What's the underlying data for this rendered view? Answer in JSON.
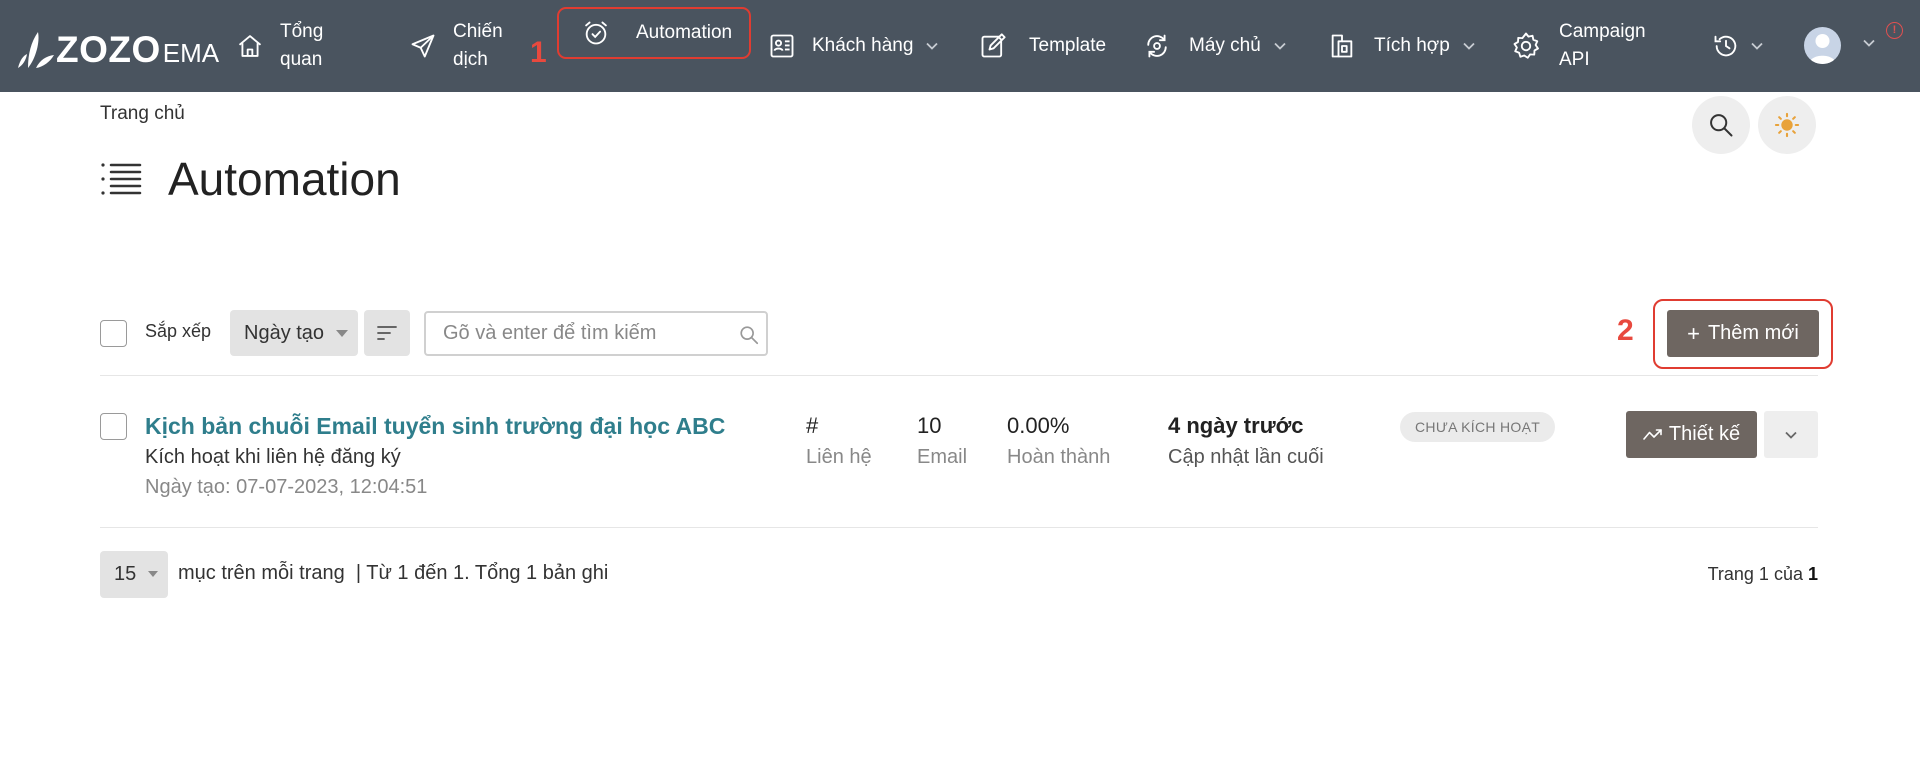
{
  "nav": {
    "brand": {
      "zozo": "ZOZO",
      "ema": "EMA"
    },
    "items": [
      {
        "label_line1": "Tổng",
        "label_line2": "quan",
        "icon": "home-icon"
      },
      {
        "label_line1": "Chiến",
        "label_line2": "dịch",
        "icon": "paper-plane-icon"
      },
      {
        "label": "Automation",
        "icon": "alarm-clock-icon",
        "active": true
      },
      {
        "label": "Khách hàng",
        "icon": "contacts-icon",
        "dropdown": true
      },
      {
        "label": "Template",
        "icon": "edit-icon"
      },
      {
        "label": "Máy chủ",
        "icon": "sync-server-icon",
        "dropdown": true
      },
      {
        "label": "Tích hợp",
        "icon": "integration-icon",
        "dropdown": true
      },
      {
        "label_line1": "Campaign",
        "label_line2": "API",
        "icon": "gear-icon"
      }
    ],
    "annotation_1": "1",
    "info_symbol": "!"
  },
  "breadcrumb": "Trang chủ",
  "page_title": "Automation",
  "toolbar": {
    "sort_label": "Sắp xếp",
    "sort_value": "Ngày tạo",
    "search_placeholder": "Gõ và enter để tìm kiếm",
    "add_label": "Thêm mới",
    "add_plus": "+",
    "annotation_2": "2"
  },
  "rows": [
    {
      "title": "Kịch bản chuỗi Email tuyển sinh trường đại học ABC",
      "trigger": "Kích hoạt khi liên hệ đăng ký",
      "created": "Ngày tạo: 07-07-2023, 12:04:51",
      "contacts_value": "#",
      "contacts_label": "Liên hệ",
      "emails_value": "10",
      "emails_label": "Email",
      "completion_value": "0.00%",
      "completion_label": "Hoàn thành",
      "updated_value": "4 ngày trước",
      "updated_label": "Cập nhật lần cuối",
      "status": "CHƯA KÍCH HOẠT",
      "design_label": "Thiết kế"
    }
  ],
  "pagination": {
    "per_page": "15",
    "per_page_text": "mục trên mỗi trang  | Từ 1 đến 1. Tổng 1 bản ghi",
    "page_prefix": "Trang 1 của",
    "total_pages": "1"
  },
  "colors": {
    "topbar": "#4a545f",
    "accent_link": "#2f7e8c",
    "primary_button": "#6e6661",
    "annotation_red": "#e03c31"
  }
}
